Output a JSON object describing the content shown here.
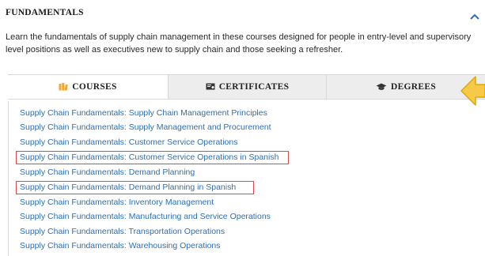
{
  "section": {
    "title": "FUNDAMENTALS",
    "description": "Learn the fundamentals of supply chain management in these courses designed for people in entry-level and supervisory level positions as well as executives new to supply chain and those seeking a refresher.",
    "collapse_icon": "chevron-up-icon"
  },
  "tabs": [
    {
      "label": "COURSES",
      "icon": "books-icon",
      "icon_color": "#f0a830",
      "active": true
    },
    {
      "label": "CERTIFICATES",
      "icon": "certificate-icon",
      "active": false
    },
    {
      "label": "DEGREES",
      "icon": "graduation-cap-icon",
      "active": false
    }
  ],
  "courses": [
    {
      "label": "Supply Chain Fundamentals: Supply Chain Management Principles",
      "highlighted": false
    },
    {
      "label": "Supply Chain Fundamentals: Supply Management and Procurement",
      "highlighted": false
    },
    {
      "label": "Supply Chain Fundamentals: Customer Service Operations",
      "highlighted": false
    },
    {
      "label": "Supply Chain Fundamentals: Customer Service Operations in Spanish",
      "highlighted": true
    },
    {
      "label": "Supply Chain Fundamentals: Demand Planning",
      "highlighted": false
    },
    {
      "label": "Supply Chain Fundamentals: Demand Planning in Spanish",
      "highlighted": true
    },
    {
      "label": "Supply Chain Fundamentals: Inventory Management",
      "highlighted": false
    },
    {
      "label": "Supply Chain Fundamentals: Manufacturing and Service Operations",
      "highlighted": false
    },
    {
      "label": "Supply Chain Fundamentals: Transportation Operations",
      "highlighted": false
    },
    {
      "label": "Supply Chain Fundamentals: Warehousing Operations",
      "highlighted": false
    }
  ],
  "colors": {
    "link": "#2f6fb0",
    "highlight_box": "#e0474c",
    "arrow_fill": "#f7c948",
    "arrow_stroke": "#e0a800",
    "inactive_tab": "#ededed"
  },
  "annotation": {
    "icon": "left-arrow-icon"
  }
}
